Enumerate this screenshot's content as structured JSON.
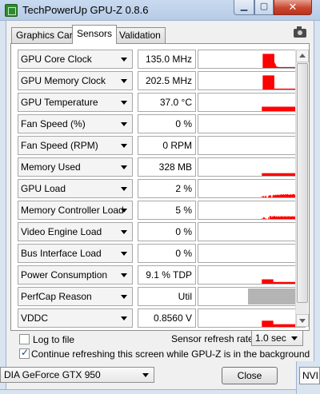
{
  "window": {
    "title": "TechPowerUp GPU-Z 0.8.6"
  },
  "tabs": [
    {
      "label": "Graphics Card",
      "active": false
    },
    {
      "label": "Sensors",
      "active": true
    },
    {
      "label": "Validation",
      "active": false
    }
  ],
  "sensors": [
    {
      "name": "GPU Core Clock",
      "value": "135.0 MHz",
      "graph": [
        0,
        0,
        0,
        0,
        0,
        0,
        0,
        0,
        0,
        0,
        0,
        0,
        0,
        0,
        0,
        0,
        0,
        0,
        0,
        0,
        0,
        0,
        0,
        0,
        0,
        0,
        0,
        0,
        0,
        0,
        0,
        0,
        0,
        0,
        0,
        0,
        0,
        0,
        0,
        0,
        0,
        0,
        0,
        0,
        0,
        0,
        0,
        0,
        0,
        0,
        0,
        0,
        0,
        0,
        0,
        0,
        0,
        0,
        0,
        0,
        0,
        0,
        0,
        0,
        0,
        0,
        0,
        0,
        0,
        0,
        0,
        0,
        0,
        0,
        0,
        0,
        0,
        0,
        0,
        0,
        0,
        0,
        0,
        0,
        0,
        0,
        0,
        0,
        0,
        0,
        0.8,
        0.8,
        0.8,
        0.8,
        0.8,
        0.8,
        0.8,
        0.8,
        0.8,
        0.8,
        0.8,
        0.8,
        0.8,
        0.8,
        0.8,
        0.8,
        0.3,
        0.22,
        0.12,
        0.08,
        0.06,
        0.06,
        0.05,
        0.05,
        0.05,
        0.05,
        0.05,
        0.05,
        0.05,
        0.05,
        0.05,
        0.05,
        0.05,
        0.05,
        0.05,
        0.05,
        0.05,
        0.05,
        0.05,
        0.05,
        0.05,
        0.05,
        0.05,
        0.05,
        0.05,
        0.05,
        0.05,
        0.05,
        0.05,
        0.05,
        0.05,
        0.05,
        0.05,
        0.05,
        0.05,
        0.05,
        0.05,
        0.05,
        0.05
      ]
    },
    {
      "name": "GPU Memory Clock",
      "value": "202.5 MHz",
      "graph": [
        0,
        0,
        0,
        0,
        0,
        0,
        0,
        0,
        0,
        0,
        0,
        0,
        0,
        0,
        0,
        0,
        0,
        0,
        0,
        0,
        0,
        0,
        0,
        0,
        0,
        0,
        0,
        0,
        0,
        0,
        0,
        0,
        0,
        0,
        0,
        0,
        0,
        0,
        0,
        0,
        0,
        0,
        0,
        0,
        0,
        0,
        0,
        0,
        0,
        0,
        0,
        0,
        0,
        0,
        0,
        0,
        0,
        0,
        0,
        0,
        0,
        0,
        0,
        0,
        0,
        0,
        0,
        0,
        0,
        0,
        0,
        0,
        0,
        0,
        0,
        0,
        0,
        0,
        0,
        0,
        0,
        0,
        0,
        0,
        0,
        0,
        0,
        0,
        0,
        0,
        0.8,
        0.8,
        0.8,
        0.8,
        0.8,
        0.8,
        0.8,
        0.8,
        0.8,
        0.8,
        0.8,
        0.8,
        0.8,
        0.8,
        0.8,
        0.8,
        0.05,
        0.05,
        0.05,
        0.05,
        0.05,
        0.05,
        0.05,
        0.05,
        0.05,
        0.05,
        0.05,
        0.05,
        0.05,
        0.05,
        0.05,
        0.05,
        0.05,
        0.05,
        0.05,
        0.05,
        0.05,
        0.05,
        0.05,
        0.05,
        0.05,
        0.05,
        0.05,
        0.05,
        0.05,
        0.05,
        0.05,
        0.05,
        0.05,
        0.05,
        0.05,
        0.05,
        0.05,
        0.05,
        0.05,
        0.05,
        0.05,
        0.05,
        0.05
      ]
    },
    {
      "name": "GPU Temperature",
      "value": "37.0 °C",
      "graph": [
        0,
        0,
        0,
        0,
        0,
        0,
        0,
        0,
        0,
        0,
        0,
        0,
        0,
        0,
        0,
        0,
        0,
        0,
        0,
        0,
        0,
        0,
        0,
        0,
        0,
        0,
        0,
        0,
        0,
        0,
        0,
        0,
        0,
        0,
        0,
        0,
        0,
        0,
        0,
        0,
        0,
        0,
        0,
        0,
        0,
        0,
        0,
        0,
        0,
        0,
        0,
        0,
        0,
        0,
        0,
        0,
        0,
        0,
        0,
        0,
        0,
        0,
        0,
        0,
        0,
        0,
        0,
        0,
        0,
        0,
        0,
        0,
        0,
        0,
        0,
        0,
        0,
        0,
        0,
        0,
        0,
        0,
        0,
        0,
        0,
        0,
        0,
        0,
        0,
        0,
        0.25,
        0.25,
        0.25,
        0.25,
        0.25,
        0.25,
        0.25,
        0.25,
        0.25,
        0.25,
        0.25,
        0.25,
        0.25,
        0.25,
        0.25,
        0.25,
        0.25,
        0.25,
        0.25,
        0.25,
        0.25,
        0.25,
        0.25,
        0.25,
        0.25,
        0.25,
        0.25,
        0.25,
        0.25,
        0.25,
        0.25,
        0.25,
        0.25,
        0.25,
        0.25,
        0.25,
        0.25,
        0.25,
        0.25,
        0.25,
        0.25,
        0.25,
        0.25,
        0.25,
        0.25,
        0.25,
        0.25,
        0.25,
        0.25,
        0.25,
        0.25,
        0.25,
        0.25,
        0.25,
        0.25,
        0.25,
        0.25,
        0.25,
        0.25,
        0.25,
        0.25
      ]
    },
    {
      "name": "Fan Speed (%)",
      "value": "0 %",
      "graph": []
    },
    {
      "name": "Fan Speed (RPM)",
      "value": "0 RPM",
      "graph": []
    },
    {
      "name": "Memory Used",
      "value": "328 MB",
      "graph": [
        0,
        0,
        0,
        0,
        0,
        0,
        0,
        0,
        0,
        0,
        0,
        0,
        0,
        0,
        0,
        0,
        0,
        0,
        0,
        0,
        0,
        0,
        0,
        0,
        0,
        0,
        0,
        0,
        0,
        0,
        0,
        0,
        0,
        0,
        0,
        0,
        0,
        0,
        0,
        0,
        0,
        0,
        0,
        0,
        0,
        0,
        0,
        0,
        0,
        0,
        0,
        0,
        0,
        0,
        0,
        0,
        0,
        0,
        0,
        0,
        0,
        0,
        0,
        0,
        0,
        0,
        0,
        0,
        0,
        0,
        0,
        0,
        0,
        0,
        0,
        0,
        0,
        0,
        0,
        0,
        0,
        0,
        0,
        0,
        0,
        0,
        0,
        0,
        0,
        0,
        0.15,
        0.15,
        0.15,
        0.15,
        0.15,
        0.15,
        0.15,
        0.15,
        0.15,
        0.15,
        0.15,
        0.15,
        0.15,
        0.15,
        0.15,
        0.15,
        0.15,
        0.15,
        0.15,
        0.15,
        0.15,
        0.15,
        0.15,
        0.15,
        0.15,
        0.15,
        0.15,
        0.15,
        0.15,
        0.15,
        0.15,
        0.15,
        0.15,
        0.15,
        0.15,
        0.15,
        0.15,
        0.15,
        0.15,
        0.15,
        0.15,
        0.15,
        0.15,
        0.15,
        0.15,
        0.15,
        0.15,
        0.15,
        0.15,
        0.15,
        0.15,
        0.15,
        0.15,
        0.15,
        0.15,
        0.15,
        0.15,
        0.15,
        0.15,
        0.15,
        0.15
      ]
    },
    {
      "name": "GPU Load",
      "value": "2 %",
      "graph": [
        0,
        0,
        0,
        0,
        0,
        0,
        0,
        0,
        0,
        0,
        0,
        0,
        0,
        0,
        0,
        0,
        0,
        0,
        0,
        0,
        0,
        0,
        0,
        0,
        0,
        0,
        0,
        0,
        0,
        0,
        0,
        0,
        0,
        0,
        0,
        0,
        0,
        0,
        0,
        0,
        0,
        0,
        0,
        0,
        0,
        0,
        0,
        0,
        0,
        0,
        0,
        0,
        0,
        0,
        0,
        0,
        0,
        0,
        0,
        0,
        0,
        0,
        0,
        0,
        0,
        0,
        0,
        0,
        0,
        0,
        0,
        0,
        0,
        0,
        0,
        0,
        0,
        0,
        0,
        0,
        0,
        0,
        0,
        0,
        0,
        0,
        0,
        0,
        0,
        0,
        0.08,
        0,
        0.08,
        0,
        0.05,
        0.1,
        0,
        0,
        0,
        0.08,
        0.12,
        0.1,
        0.12,
        0,
        0,
        0.1,
        0.15,
        0.12,
        0.12,
        0.15,
        0.12,
        0.15,
        0.15,
        0.15,
        0.12,
        0.15,
        0.15,
        0.18,
        0.15,
        0.15,
        0.18,
        0.15,
        0.15,
        0.18,
        0.15,
        0.18,
        0.18,
        0.15,
        0.15,
        0.15,
        0.18,
        0.15,
        0.15,
        0.18,
        0.18,
        0.18,
        0.15,
        0.15,
        0.18,
        0.15,
        0.4,
        0.15,
        0.15,
        0.15,
        0.15,
        0.15,
        0.15,
        0.15,
        0.15,
        0.15,
        0.15
      ]
    },
    {
      "name": "Memory Controller Load",
      "value": "5 %",
      "graph": [
        0,
        0,
        0,
        0,
        0,
        0,
        0,
        0,
        0,
        0,
        0,
        0,
        0,
        0,
        0,
        0,
        0,
        0,
        0,
        0,
        0,
        0,
        0,
        0,
        0,
        0,
        0,
        0,
        0,
        0,
        0,
        0,
        0,
        0,
        0,
        0,
        0,
        0,
        0,
        0,
        0,
        0,
        0,
        0,
        0,
        0,
        0,
        0,
        0,
        0,
        0,
        0,
        0,
        0,
        0,
        0,
        0,
        0,
        0,
        0,
        0,
        0,
        0,
        0,
        0,
        0,
        0,
        0,
        0,
        0,
        0,
        0,
        0,
        0,
        0,
        0,
        0,
        0,
        0,
        0,
        0,
        0,
        0,
        0,
        0,
        0,
        0,
        0,
        0,
        0,
        0.05,
        0,
        0.1,
        0.08,
        0,
        0.05,
        0,
        0,
        0,
        0.1,
        0,
        0.18,
        0.15,
        0.1,
        0.15,
        0.12,
        0.15,
        0.18,
        0.15,
        0.12,
        0.15,
        0.15,
        0.12,
        0.15,
        0.15,
        0.12,
        0.15,
        0.15,
        0.15,
        0.15,
        0.12,
        0.15,
        0.15,
        0.15,
        0.15,
        0.12,
        0.15,
        0.15,
        0.15,
        0.15,
        0.12,
        0.15,
        0.15,
        0.15,
        0.15,
        0.12,
        0.15,
        0.15,
        0.15,
        0.15,
        0.15,
        0.15,
        0.15,
        0.15,
        0.15,
        0.15,
        0.15,
        0.15,
        0.15,
        0.15,
        0.15
      ]
    },
    {
      "name": "Video Engine Load",
      "value": "0 %",
      "graph": []
    },
    {
      "name": "Bus Interface Load",
      "value": "0 %",
      "graph": []
    },
    {
      "name": "Power Consumption",
      "value": "9.1 % TDP",
      "graph": [
        0,
        0,
        0,
        0,
        0,
        0,
        0,
        0,
        0,
        0,
        0,
        0,
        0,
        0,
        0,
        0,
        0,
        0,
        0,
        0,
        0,
        0,
        0,
        0,
        0,
        0,
        0,
        0,
        0,
        0,
        0,
        0,
        0,
        0,
        0,
        0,
        0,
        0,
        0,
        0,
        0,
        0,
        0,
        0,
        0,
        0,
        0,
        0,
        0,
        0,
        0,
        0,
        0,
        0,
        0,
        0,
        0,
        0,
        0,
        0,
        0,
        0,
        0,
        0,
        0,
        0,
        0,
        0,
        0,
        0,
        0,
        0,
        0,
        0,
        0,
        0,
        0,
        0,
        0,
        0,
        0,
        0,
        0,
        0,
        0,
        0,
        0,
        0,
        0,
        0,
        0.25,
        0.25,
        0.25,
        0.25,
        0.25,
        0.25,
        0.25,
        0.25,
        0.25,
        0.25,
        0.25,
        0.25,
        0.25,
        0.25,
        0.25,
        0.25,
        0.1,
        0.1,
        0.1,
        0.1,
        0.1,
        0.1,
        0.1,
        0.1,
        0.1,
        0.1,
        0.1,
        0.1,
        0.1,
        0.1,
        0.1,
        0.1,
        0.1,
        0.1,
        0.1,
        0.1,
        0.1,
        0.1,
        0.1,
        0.1,
        0.1,
        0.1,
        0.1,
        0.1,
        0.1,
        0.1,
        0.1,
        0.1,
        0.1,
        0.1,
        0.1,
        0.1,
        0.1,
        0.1,
        0.1,
        0.1,
        0.1,
        0.1,
        0.1,
        0.1,
        0.1
      ]
    },
    {
      "name": "PerfCap Reason",
      "value": "Util",
      "graph": [],
      "graph_fill": "#b4b4b4"
    },
    {
      "name": "VDDC",
      "value": "0.8560 V",
      "graph": [
        0,
        0,
        0,
        0,
        0,
        0,
        0,
        0,
        0,
        0,
        0,
        0,
        0,
        0,
        0,
        0,
        0,
        0,
        0,
        0,
        0,
        0,
        0,
        0,
        0,
        0,
        0,
        0,
        0,
        0,
        0,
        0,
        0,
        0,
        0,
        0,
        0,
        0,
        0,
        0,
        0,
        0,
        0,
        0,
        0,
        0,
        0,
        0,
        0,
        0,
        0,
        0,
        0,
        0,
        0,
        0,
        0,
        0,
        0,
        0,
        0,
        0,
        0,
        0,
        0,
        0,
        0,
        0,
        0,
        0,
        0,
        0,
        0,
        0,
        0,
        0,
        0,
        0,
        0,
        0,
        0,
        0,
        0,
        0,
        0,
        0,
        0,
        0,
        0,
        0,
        0.35,
        0.35,
        0.35,
        0.35,
        0.35,
        0.35,
        0.35,
        0.35,
        0.35,
        0.35,
        0.35,
        0.35,
        0.35,
        0.35,
        0.35,
        0.35,
        0.15,
        0.15,
        0.15,
        0.15,
        0.15,
        0.15,
        0.15,
        0.15,
        0.15,
        0.15,
        0.15,
        0.15,
        0.15,
        0.15,
        0.15,
        0.15,
        0.15,
        0.15,
        0.15,
        0.15,
        0.15,
        0.15,
        0.15,
        0.15,
        0.15,
        0.15,
        0.15,
        0.15,
        0.15,
        0.15,
        0.15,
        0.15,
        0.15,
        0.15,
        0.15,
        0.15,
        0.15,
        0.15,
        0.15,
        0.15,
        0.15,
        0.15,
        0.15,
        0.15,
        0.15
      ]
    }
  ],
  "options": {
    "log_to_file": {
      "label": "Log to file",
      "checked": false
    },
    "refresh_rate": {
      "label": "Sensor refresh rate:",
      "value": "1.0 sec"
    },
    "continue_refresh": {
      "label": "Continue refreshing this screen while GPU-Z is in the background",
      "checked": true
    }
  },
  "footer": {
    "gpu_select": "DIA GeForce GTX 950",
    "close_label": "Close",
    "next_window_select": "NVI"
  },
  "colors": {
    "graph": "#ff0000",
    "perfcap": "#b4b4b4",
    "panel_bg": "#ffffff",
    "window_bg": "#f0f0f0"
  }
}
